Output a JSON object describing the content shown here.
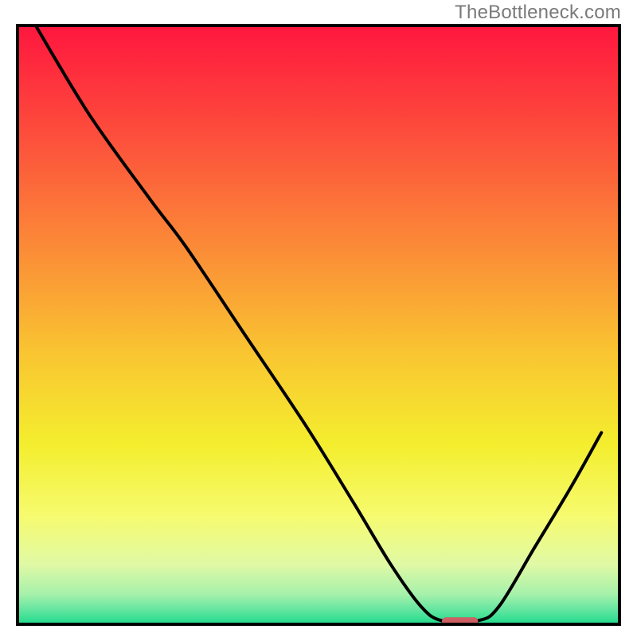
{
  "watermark": "TheBottleneck.com",
  "chart_data": {
    "type": "line",
    "title": "",
    "xlabel": "",
    "ylabel": "",
    "xlim": [
      0,
      100
    ],
    "ylim": [
      0,
      100
    ],
    "grid": false,
    "note": "Axes unlabeled; values are estimated relative pixel positions on a 0–100 scale. y=0 at bottom, y=100 at top. The plot region is bounded by a black rectangle with a heat-gradient fill (red→green) and a single black V-shaped curve.",
    "series": [
      {
        "name": "bottleneck-curve",
        "points": [
          {
            "x": 3.0,
            "y": 100.0
          },
          {
            "x": 12.0,
            "y": 85.0
          },
          {
            "x": 22.0,
            "y": 71.0
          },
          {
            "x": 28.0,
            "y": 63.0
          },
          {
            "x": 38.0,
            "y": 48.0
          },
          {
            "x": 48.0,
            "y": 33.0
          },
          {
            "x": 56.0,
            "y": 20.0
          },
          {
            "x": 62.0,
            "y": 10.0
          },
          {
            "x": 67.0,
            "y": 3.0
          },
          {
            "x": 70.5,
            "y": 0.6
          },
          {
            "x": 76.5,
            "y": 0.6
          },
          {
            "x": 80.0,
            "y": 3.0
          },
          {
            "x": 86.0,
            "y": 13.0
          },
          {
            "x": 92.0,
            "y": 23.0
          },
          {
            "x": 97.0,
            "y": 32.0
          }
        ]
      }
    ],
    "marker": {
      "name": "optimal-zone",
      "type": "rounded-bar",
      "color": "#cd5f63",
      "x_start": 70.5,
      "x_end": 76.5,
      "y": 0.5
    },
    "gradient_stops": [
      {
        "offset": 0.0,
        "color": "#fe163e"
      },
      {
        "offset": 0.18,
        "color": "#fd4d3c"
      },
      {
        "offset": 0.38,
        "color": "#fb8e37"
      },
      {
        "offset": 0.55,
        "color": "#f9c631"
      },
      {
        "offset": 0.7,
        "color": "#f4ee2e"
      },
      {
        "offset": 0.82,
        "color": "#f6fb6f"
      },
      {
        "offset": 0.9,
        "color": "#e0f9a5"
      },
      {
        "offset": 0.95,
        "color": "#a6f1ab"
      },
      {
        "offset": 0.975,
        "color": "#65e6a0"
      },
      {
        "offset": 1.0,
        "color": "#1fdb8d"
      }
    ],
    "border_color": "#000000"
  }
}
